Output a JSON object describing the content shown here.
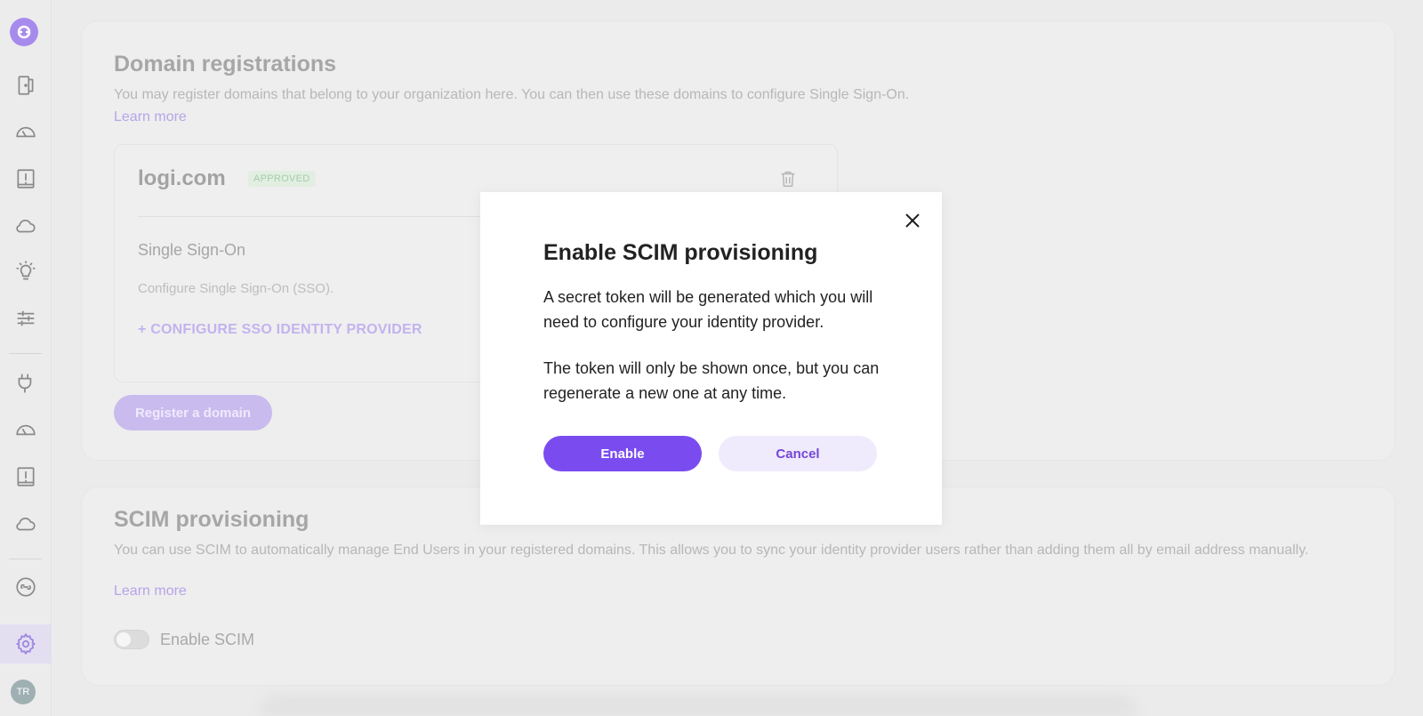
{
  "sidebar": {
    "items": [
      {
        "icon": "door-icon"
      },
      {
        "icon": "gauge-icon"
      },
      {
        "icon": "alert-box-icon"
      },
      {
        "icon": "cloud-icon"
      },
      {
        "icon": "lightbulb-icon"
      },
      {
        "icon": "sliders-icon"
      },
      {
        "icon": "plug-icon"
      },
      {
        "icon": "gauge-icon"
      },
      {
        "icon": "alert-box-icon"
      },
      {
        "icon": "cloud-icon"
      },
      {
        "icon": "link-icon"
      },
      {
        "icon": "gear-icon"
      }
    ],
    "active_item": "gear-icon",
    "avatar_initials": "TR"
  },
  "domain_registrations": {
    "title": "Domain registrations",
    "description": "You may register domains that belong to your organization here. You can then use these domains to configure Single Sign-On.",
    "learn_more": "Learn more",
    "domain": {
      "name": "logi.com",
      "status": "APPROVED",
      "sso_title": "Single Sign-On",
      "sso_description": "Configure Single Sign-On (SSO).",
      "configure_link": "+ CONFIGURE SSO IDENTITY PROVIDER"
    },
    "register_button": "Register a domain"
  },
  "scim_provisioning": {
    "title": "SCIM provisioning",
    "description": "You can use SCIM to automatically manage End Users in your registered domains. This allows you to sync your identity provider users rather than adding them all by email address manually.",
    "learn_more": "Learn more",
    "toggle_label": "Enable SCIM",
    "toggle_on": false
  },
  "modal": {
    "title": "Enable SCIM provisioning",
    "paragraph1": "A secret token will be generated which you will need to configure your identity provider.",
    "paragraph2": "The token will only be shown once, but you can regenerate a new one at any time.",
    "enable_button": "Enable",
    "cancel_button": "Cancel"
  },
  "colors": {
    "accent": "#7a4cf0",
    "accent_light": "#efeafc",
    "approved_green": "#a3cfa5"
  }
}
